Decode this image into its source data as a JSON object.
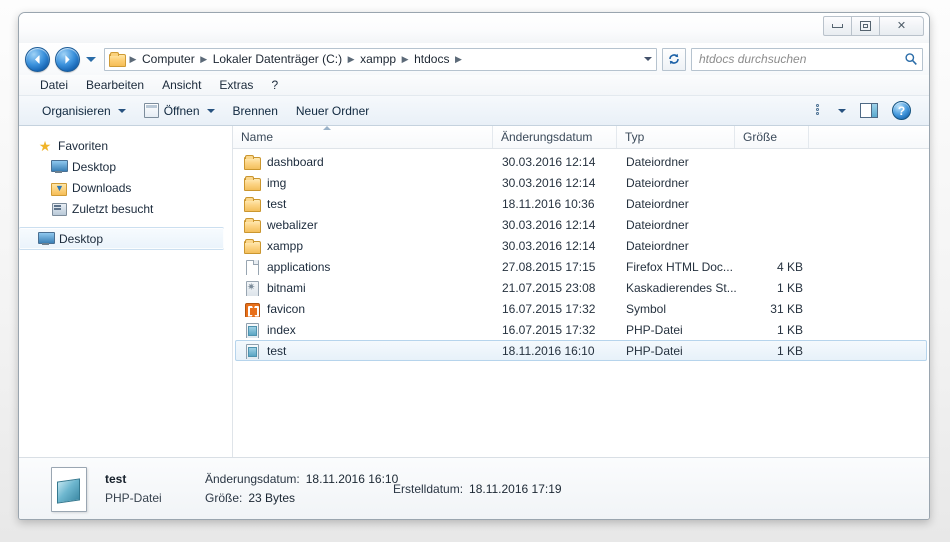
{
  "window": {
    "buttons": {
      "minimize": "minimize",
      "restore": "restore",
      "close": "✕"
    }
  },
  "nav": {
    "back_label": "Zurück",
    "forward_label": "Vorwärts",
    "history_label": "Letzte Seiten",
    "refresh_label": "Aktualisieren",
    "breadcrumb": [
      "Computer",
      "Lokaler Datenträger (C:)",
      "xampp",
      "htdocs"
    ],
    "separator": "▶"
  },
  "search": {
    "placeholder": "htdocs durchsuchen",
    "icon": "search-icon"
  },
  "menubar": {
    "items": [
      "Datei",
      "Bearbeiten",
      "Ansicht",
      "Extras",
      "?"
    ]
  },
  "toolbar": {
    "organize": "Organisieren",
    "open": "Öffnen",
    "burn": "Brennen",
    "new_folder": "Neuer Ordner",
    "views_label": "Ansicht ändern",
    "preview_label": "Vorschaufenster",
    "help_label": "?"
  },
  "sidebar": {
    "favorites": {
      "label": "Favoriten",
      "icon": "star-icon"
    },
    "items": [
      {
        "label": "Desktop",
        "icon": "monitor-icon"
      },
      {
        "label": "Downloads",
        "icon": "downloads-folder-icon"
      },
      {
        "label": "Zuletzt besucht",
        "icon": "recent-places-icon"
      }
    ],
    "selected": {
      "label": "Desktop",
      "icon": "monitor-icon"
    }
  },
  "filelist": {
    "columns": [
      "Name",
      "Änderungsdatum",
      "Typ",
      "Größe"
    ],
    "sort": {
      "column": "Name",
      "direction": "ascending"
    },
    "rows": [
      {
        "name": "dashboard",
        "date": "30.03.2016 12:14",
        "type": "Dateiordner",
        "size": "",
        "icon": "folder-icon",
        "selected": false
      },
      {
        "name": "img",
        "date": "30.03.2016 12:14",
        "type": "Dateiordner",
        "size": "",
        "icon": "folder-icon",
        "selected": false
      },
      {
        "name": "test",
        "date": "18.11.2016 10:36",
        "type": "Dateiordner",
        "size": "",
        "icon": "folder-icon",
        "selected": false
      },
      {
        "name": "webalizer",
        "date": "30.03.2016 12:14",
        "type": "Dateiordner",
        "size": "",
        "icon": "folder-icon",
        "selected": false
      },
      {
        "name": "xampp",
        "date": "30.03.2016 12:14",
        "type": "Dateiordner",
        "size": "",
        "icon": "folder-icon",
        "selected": false
      },
      {
        "name": "applications",
        "date": "27.08.2015 17:15",
        "type": "Firefox HTML Doc...",
        "size": "4 KB",
        "icon": "html-file-icon",
        "selected": false
      },
      {
        "name": "bitnami",
        "date": "21.07.2015 23:08",
        "type": "Kaskadierendes St...",
        "size": "1 KB",
        "icon": "css-file-icon",
        "selected": false
      },
      {
        "name": "favicon",
        "date": "16.07.2015 17:32",
        "type": "Symbol",
        "size": "31 KB",
        "icon": "icon-file-icon",
        "selected": false
      },
      {
        "name": "index",
        "date": "16.07.2015 17:32",
        "type": "PHP-Datei",
        "size": "1 KB",
        "icon": "php-file-icon",
        "selected": false
      },
      {
        "name": "test",
        "date": "18.11.2016 16:10",
        "type": "PHP-Datei",
        "size": "1 KB",
        "icon": "php-file-icon",
        "selected": true
      }
    ]
  },
  "details": {
    "filename": "test",
    "filetype": "PHP-Datei",
    "modified_label": "Änderungsdatum:",
    "modified_value": "18.11.2016 16:10",
    "size_label": "Größe:",
    "size_value": "23 Bytes",
    "created_label": "Erstelldatum:",
    "created_value": "18.11.2016 17:19"
  },
  "colors": {
    "accent": "#1766b5",
    "folder": "#f3bf5c",
    "selection": "#e7f1f9",
    "favicon": "#e8701a"
  }
}
